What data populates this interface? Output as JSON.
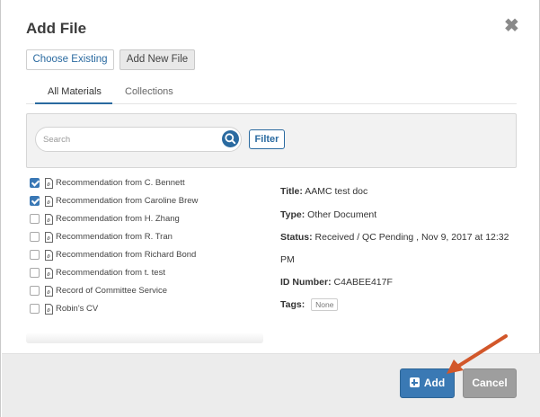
{
  "modal": {
    "title": "Add File",
    "close_icon": "close-icon"
  },
  "source_tabs": {
    "choose_existing": "Choose Existing",
    "add_new_file": "Add New File",
    "active": "choose_existing"
  },
  "material_tabs": {
    "all_materials": "All Materials",
    "collections": "Collections",
    "active": "all_materials"
  },
  "search": {
    "placeholder": "Search",
    "value": "",
    "icon": "search-icon",
    "filter_label": "Filter"
  },
  "files": [
    {
      "label": "Recommendation from C. Bennett",
      "checked": true,
      "icon": "pdf-file-icon"
    },
    {
      "label": "Recommendation from Caroline Brew",
      "checked": true,
      "icon": "pdf-file-icon"
    },
    {
      "label": "Recommendation from H. Zhang",
      "checked": false,
      "icon": "pdf-file-icon"
    },
    {
      "label": "Recommendation from R. Tran",
      "checked": false,
      "icon": "pdf-file-icon"
    },
    {
      "label": "Recommendation from Richard Bond",
      "checked": false,
      "icon": "pdf-file-icon"
    },
    {
      "label": "Recommendation from t. test",
      "checked": false,
      "icon": "pdf-file-icon"
    },
    {
      "label": "Record of Committee Service",
      "checked": false,
      "icon": "pdf-file-icon"
    },
    {
      "label": "Robin's CV",
      "checked": false,
      "icon": "pdf-file-icon"
    }
  ],
  "details": {
    "title_label": "Title:",
    "title_value": "AAMC test doc",
    "type_label": "Type:",
    "type_value": "Other Document",
    "status_label": "Status:",
    "status_value": "Received / QC Pending , Nov 9, 2017 at 12:32",
    "status_value_cont": "PM",
    "id_label": "ID Number:",
    "id_value": "C4ABEE417F",
    "tags_label": "Tags:",
    "tags_value": "None"
  },
  "footer": {
    "add_label": "Add",
    "cancel_label": "Cancel"
  },
  "colors": {
    "accent": "#2a6aa0",
    "add_button": "#3a79b4",
    "cancel_button": "#9e9e9e",
    "annotation_arrow": "#d2572a"
  }
}
